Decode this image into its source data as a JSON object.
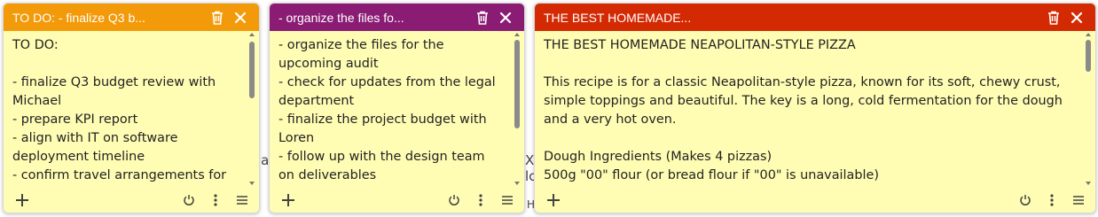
{
  "background": {
    "fragments": [
      "la",
      "X",
      "lc",
      "H"
    ]
  },
  "notes": [
    {
      "title": "TO DO: - finalize Q3 b...",
      "color": "#f39a0a",
      "body": "TO DO:\n\n- finalize Q3 budget review with Michael\n- prepare KPI report\n- align with IT on software deployment timeline\n- confirm travel arrangements for"
    },
    {
      "title": "- organize the files fo...",
      "color": "#8b1c74",
      "body": "- organize the files for the upcoming audit\n- check for updates from the legal department\n- finalize the project budget with Loren\n- follow up with the design team on deliverables"
    },
    {
      "title": "THE BEST HOMEMADE...",
      "color": "#d42a04",
      "body": "THE BEST HOMEMADE NEAPOLITAN-STYLE PIZZA\n\nThis recipe is for a classic Neapolitan-style pizza, known for its soft, chewy crust, simple toppings and beautiful. The key is a long, cold fermentation for the dough and a very hot oven.\n\nDough Ingredients (Makes 4 pizzas)\n500g \"00\" flour (or bread flour if \"00\" is unavailable)"
    }
  ],
  "icons": {
    "delete": "trash-icon",
    "close": "close-icon",
    "add": "plus-icon",
    "power": "power-icon",
    "more": "more-vertical-icon",
    "menu": "menu-icon"
  }
}
